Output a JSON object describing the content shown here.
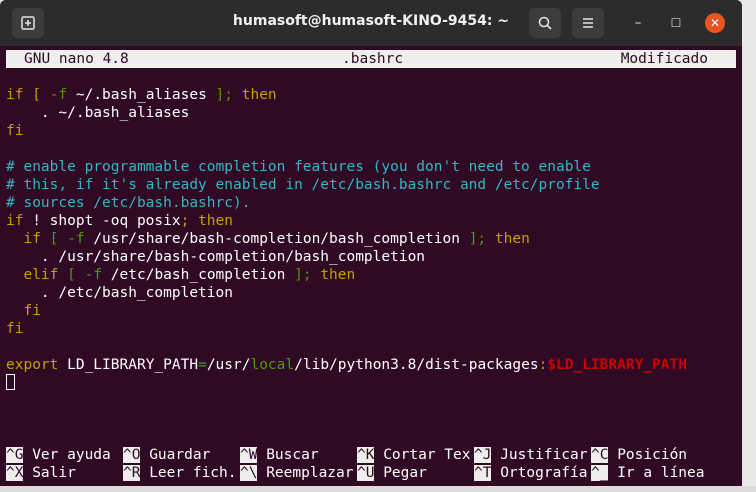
{
  "window": {
    "title": "humasoft@humasoft-KINO-9454: ~",
    "new_tab_icon": "new-tab-icon",
    "search_icon": "search-icon",
    "menu_icon": "hamburger-menu-icon",
    "minimize_glyph": "–",
    "maximize_glyph": "☐",
    "close_glyph": "✕"
  },
  "nano": {
    "version": "GNU nano 4.8",
    "filename": ".bashrc",
    "status": "Modificado"
  },
  "code": {
    "l1a": "if [ ",
    "l1b": "-f",
    "l1c": " ~/.bash_aliases ",
    "l1d": "];",
    "l1e": " then",
    "l2": "    . ~/.bash_aliases",
    "l3": "fi",
    "l4": "# enable programmable completion features (you don't need to enable",
    "l5": "# this, if it's already enabled in /etc/bash.bashrc and /etc/profile",
    "l6": "# sources /etc/bash.bashrc).",
    "l7a": "if",
    "l7b": " ! shopt -oq posix",
    "l7c": ";",
    "l7d": " then",
    "l8a": "  if",
    "l8b": " [ ",
    "l8c": "-f",
    "l8d": " /usr/share/bash-completion/bash_completion ",
    "l8e": "];",
    "l8f": " then",
    "l9": "    . /usr/share/bash-completion/bash_completion",
    "l10a": "  elif",
    "l10b": " [ ",
    "l10c": "-f",
    "l10d": " /etc/bash_completion ",
    "l10e": "];",
    "l10f": " then",
    "l11": "    . /etc/bash_completion",
    "l12": "  fi",
    "l13": "fi",
    "l14a": "export",
    "l14b": " LD_LIBRARY_PATH",
    "l14c": "=",
    "l14d": "/usr/",
    "l14e": "local",
    "l14f": "/lib/python3.8/dist-packages",
    "l14g": ":",
    "l14h": "$LD_LIBRARY_PATH"
  },
  "shortcuts": [
    {
      "key": "^G",
      "label": " Ver ayuda"
    },
    {
      "key": "^O",
      "label": " Guardar"
    },
    {
      "key": "^W",
      "label": " Buscar"
    },
    {
      "key": "^K",
      "label": " Cortar Tex"
    },
    {
      "key": "^J",
      "label": " Justificar"
    },
    {
      "key": "^C",
      "label": " Posición"
    },
    {
      "key": "^X",
      "label": " Salir"
    },
    {
      "key": "^R",
      "label": " Leer fich."
    },
    {
      "key": "^\\",
      "label": " Reemplazar"
    },
    {
      "key": "^U",
      "label": " Pegar"
    },
    {
      "key": "^T",
      "label": " Ortografía"
    },
    {
      "key": "^_",
      "label": " Ir a línea"
    }
  ],
  "colors": {
    "terminal_bg": "#300a24",
    "comment": "#34b6c4",
    "keyword": "#c4a000",
    "variable": "#cc0000",
    "close_button": "#e95420"
  }
}
